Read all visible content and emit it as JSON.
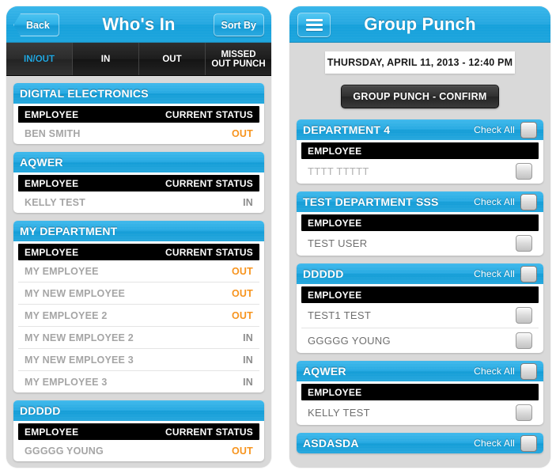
{
  "left_screen": {
    "nav": {
      "back_label": "Back",
      "title": "Who's In",
      "sort_label": "Sort By"
    },
    "tabs": [
      {
        "label": "IN/OUT",
        "label2": "",
        "active": true
      },
      {
        "label": "IN",
        "label2": "",
        "active": false
      },
      {
        "label": "OUT",
        "label2": "",
        "active": false
      },
      {
        "label": "MISSED",
        "label2": "OUT PUNCH",
        "active": false
      }
    ],
    "column_headers": {
      "employee": "EMPLOYEE",
      "status": "CURRENT STATUS"
    },
    "departments": [
      {
        "name": "DIGITAL ELECTRONICS",
        "employees": [
          {
            "name": "BEN SMITH",
            "status": "OUT"
          }
        ]
      },
      {
        "name": "AQWER",
        "employees": [
          {
            "name": "KELLY TEST",
            "status": "IN"
          }
        ]
      },
      {
        "name": "MY DEPARTMENT",
        "employees": [
          {
            "name": "MY EMPLOYEE",
            "status": "OUT"
          },
          {
            "name": "MY NEW EMPLOYEE",
            "status": "OUT"
          },
          {
            "name": "MY EMPLOYEE 2",
            "status": "OUT"
          },
          {
            "name": "MY NEW EMPLOYEE 2",
            "status": "IN"
          },
          {
            "name": "MY NEW EMPLOYEE 3",
            "status": "IN"
          },
          {
            "name": "MY EMPLOYEE 3",
            "status": "IN"
          }
        ]
      },
      {
        "name": "DDDDD",
        "employees": [
          {
            "name": "GGGGG YOUNG",
            "status": "OUT"
          }
        ]
      }
    ]
  },
  "right_screen": {
    "nav": {
      "menu_icon": "hamburger-icon",
      "title": "Group Punch"
    },
    "date_time": "THURSDAY, APRIL 11, 2013 - 12:40 PM",
    "confirm_label": "GROUP PUNCH - CONFIRM",
    "check_all_label": "Check All",
    "column_header_employee": "EMPLOYEE",
    "departments": [
      {
        "name": "DEPARTMENT 4",
        "employees": [
          {
            "name": "TTTT TTTTT",
            "checked": false
          }
        ]
      },
      {
        "name": "TEST DEPARTMENT SSS",
        "employees": [
          {
            "name": "TEST USER",
            "checked": false
          }
        ]
      },
      {
        "name": "DDDDD",
        "employees": [
          {
            "name": "TEST1 TEST",
            "checked": false
          },
          {
            "name": "GGGGG YOUNG",
            "checked": false
          }
        ]
      },
      {
        "name": "AQWER",
        "employees": [
          {
            "name": "KELLY TEST",
            "checked": false
          }
        ]
      },
      {
        "name": "ASDASDA",
        "employees": []
      }
    ]
  },
  "colors": {
    "brand_blue": "#23a7e0",
    "status_out": "#f7941e",
    "header_black": "#000000",
    "panel_background": "#d9d9d9"
  }
}
